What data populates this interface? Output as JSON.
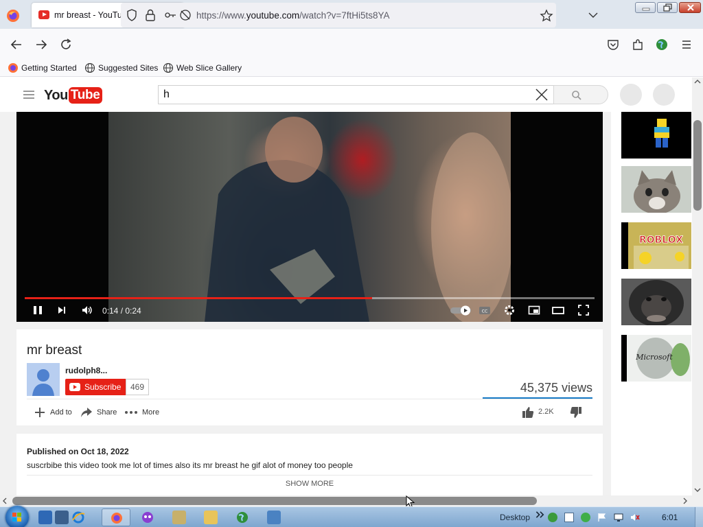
{
  "browser": {
    "tab_title": "mr breast - YouTube",
    "url_prefix": "https://www.",
    "url_host": "youtube.com",
    "url_path": "/watch?v=7ftHi5ts8YA",
    "bookmarks": [
      "Getting Started",
      "Suggested Sites",
      "Web Slice Gallery"
    ]
  },
  "youtube": {
    "logo_you": "You",
    "logo_tube": "Tube",
    "search_value": "h"
  },
  "player": {
    "time_display": "0:14 / 0:24",
    "progress_fraction": 0.61
  },
  "video": {
    "title": "mr breast",
    "channel": "rudolph8...",
    "subscribe_label": "Subscribe",
    "subscriber_count": "469",
    "views": "45,375 views",
    "add_to_label": "Add to",
    "share_label": "Share",
    "more_label": "More",
    "like_count": "2.2K",
    "published": "Published on Oct 18, 2022",
    "description": "suscrbibe this video took me lot of times also its mr breast he gif alot of money too people",
    "show_more_label": "SHOW MORE"
  },
  "sidebar": {
    "thumbnails": [
      "roblox-noob",
      "cat-face",
      "roblox-logo",
      "gorilla-face",
      "microsoft-logo-3d"
    ],
    "thumbnail_texts": [
      "ROBLOX",
      "Microsoft"
    ]
  },
  "taskbar": {
    "desktop_label": "Desktop",
    "clock": "6:01"
  },
  "colors": {
    "youtube_red": "#e62117",
    "progress_red": "#e62117",
    "sentiment_blue": "#167ac6",
    "taskbar": "#8fb3d8"
  }
}
